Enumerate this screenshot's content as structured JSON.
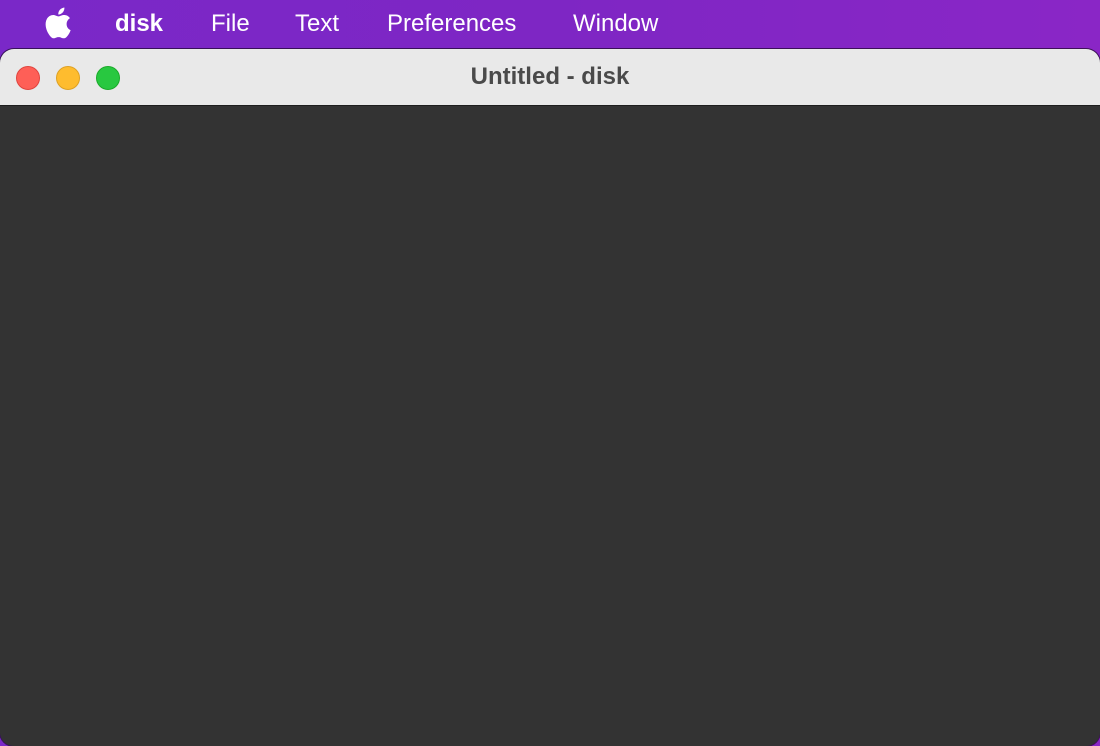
{
  "menubar": {
    "apple_icon": "apple-logo",
    "app_name": "disk",
    "items": [
      {
        "label": "File"
      },
      {
        "label": "Text"
      },
      {
        "label": "Preferences"
      },
      {
        "label": "Window"
      }
    ]
  },
  "window": {
    "title": "Untitled - disk",
    "buttons": {
      "close_color": "#fe5f57",
      "minimize_color": "#febc2e",
      "zoom_color": "#28c840"
    },
    "content_background": "#333333"
  },
  "colors": {
    "menubar_background": "#7e26c4",
    "titlebar_background": "#e9e9e9"
  }
}
